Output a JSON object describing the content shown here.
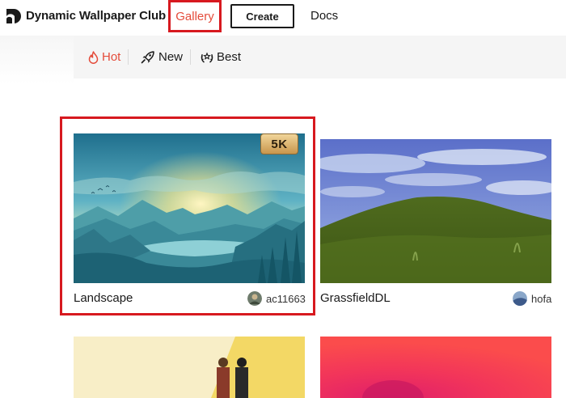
{
  "header": {
    "brand": "Dynamic Wallpaper Club",
    "nav": {
      "gallery": "Gallery",
      "create": "Create",
      "docs": "Docs"
    }
  },
  "filters": {
    "hot": "Hot",
    "new": "New",
    "best": "Best"
  },
  "cards": [
    {
      "title": "Landscape",
      "author": "ac11663",
      "badge": "5K"
    },
    {
      "title": "GrassfieldDL",
      "author": "hofa"
    },
    {
      "title": ""
    },
    {
      "title": ""
    }
  ],
  "colors": {
    "accent": "#e44c3b",
    "highlight_border": "#d7191f"
  }
}
